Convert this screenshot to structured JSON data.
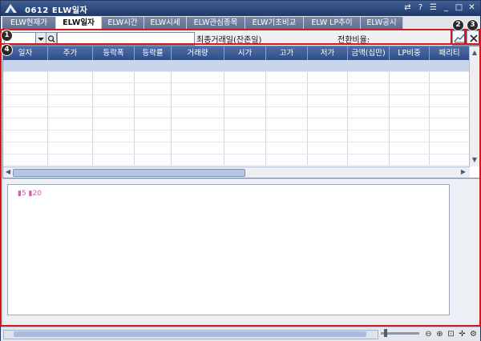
{
  "window": {
    "title": "0612 ELW일자",
    "controls": [
      "link-icon",
      "help-icon",
      "menu-icon",
      "minimize-icon",
      "maximize-icon",
      "close-icon"
    ]
  },
  "tabs": [
    {
      "label": "ELW현재가",
      "active": false
    },
    {
      "label": "ELW일자",
      "active": true
    },
    {
      "label": "ELW시간",
      "active": false
    },
    {
      "label": "ELW시세",
      "active": false
    },
    {
      "label": "ELW관심종목",
      "active": false
    },
    {
      "label": "ELW기초비교",
      "active": false
    },
    {
      "label": "ELW LP추이",
      "active": false
    },
    {
      "label": "ELW공시",
      "active": false
    }
  ],
  "search": {
    "code_value": "",
    "name_value": "",
    "last_trade_label": "최종거래일(잔존일)",
    "conversion_label": "전환비율:"
  },
  "table": {
    "columns": [
      "일자",
      "주가",
      "등락폭",
      "등락률",
      "거래량",
      "시가",
      "고가",
      "저가",
      "금액(십만)",
      "LP비중",
      "패리티"
    ],
    "row_count": 9
  },
  "chart": {
    "legend": "▮5 ▮20"
  },
  "markers": [
    "1",
    "2",
    "3",
    "4"
  ],
  "colors": {
    "accent": "#2f4c84",
    "annotation": "#d4171c",
    "legend": "#d25fa8"
  }
}
